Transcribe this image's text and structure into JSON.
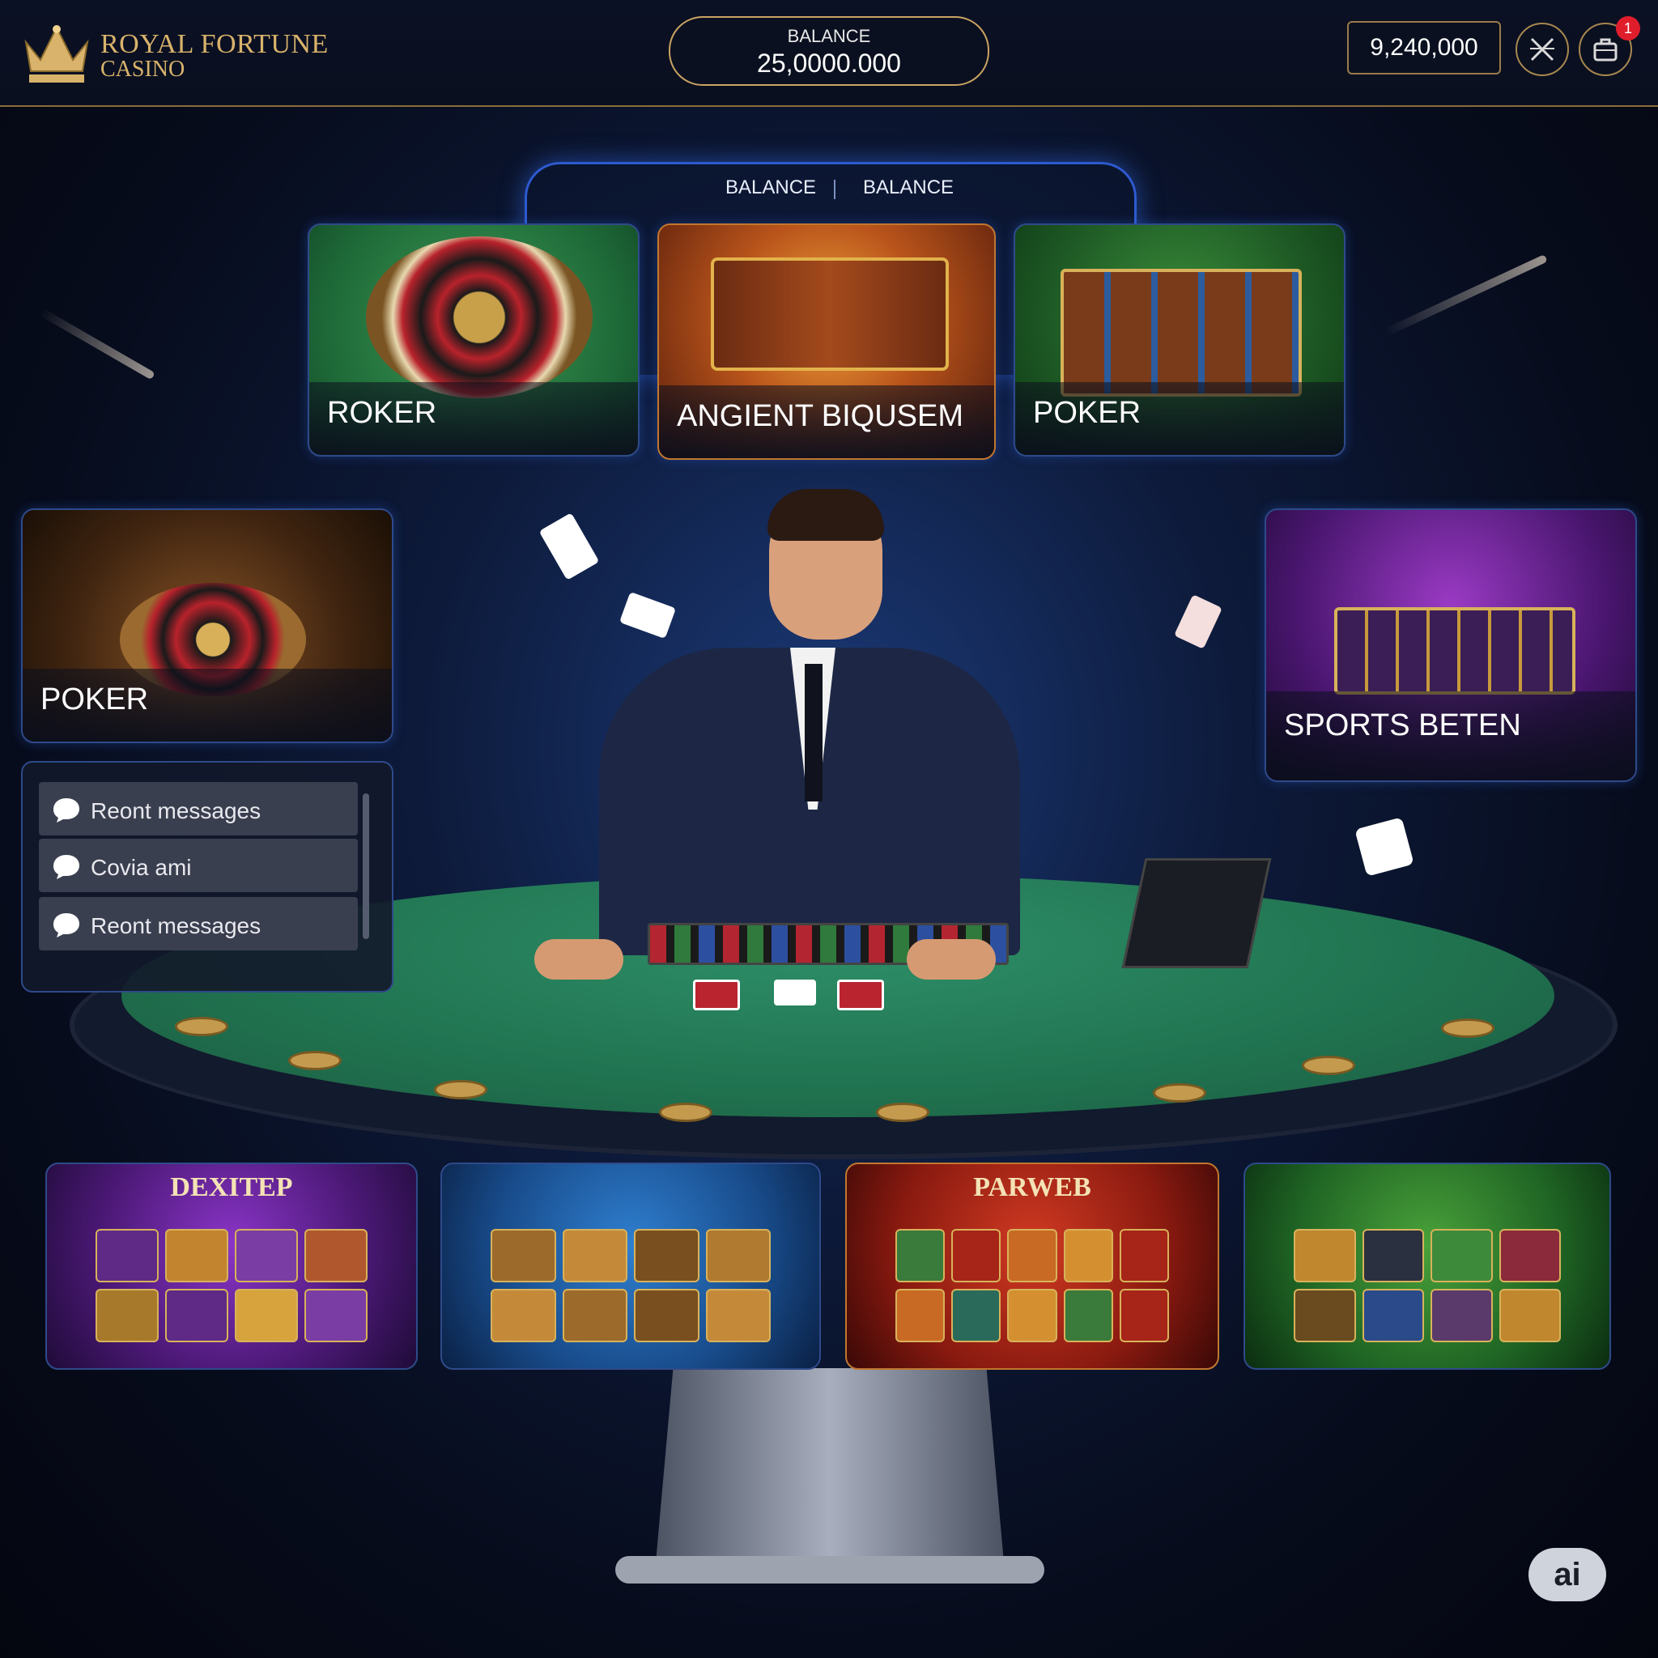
{
  "brand": {
    "line1": "ROYAL FORTUNE",
    "line2": "CASINO"
  },
  "header": {
    "balance_label": "BALANCE",
    "balance_value": "25,0000.000",
    "coins_value": "9,240,000",
    "notification_count": "1"
  },
  "tabs": {
    "left": "BALANCE",
    "right": "BALANCE"
  },
  "featured_games": [
    {
      "title": "ROKER"
    },
    {
      "title": "ANGIENT BIQUSEM"
    },
    {
      "title": "POKER"
    }
  ],
  "side_games": [
    {
      "title": "POKER"
    },
    {
      "title": "SPORTS BETEN"
    }
  ],
  "messages": [
    {
      "label": "Reont messages"
    },
    {
      "label": "Covia ami"
    },
    {
      "label": "Reont messages"
    }
  ],
  "slots": [
    {
      "title": "DEXITEP"
    },
    {
      "title": ""
    },
    {
      "title": "PARWEB"
    },
    {
      "title": ""
    }
  ],
  "assistant_badge": "ai",
  "colors": {
    "gold": "#d9b36b",
    "accent_blue": "#2d5ad0",
    "felt_green": "#20724f"
  }
}
